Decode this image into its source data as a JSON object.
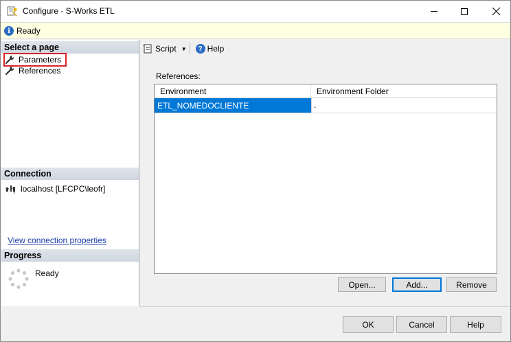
{
  "window": {
    "title": "Configure - S-Works ETL",
    "icon": "configure-icon"
  },
  "status": {
    "text": "Ready",
    "icon": "info-icon"
  },
  "select_page": {
    "header": "Select a page",
    "items": [
      {
        "label": "Parameters",
        "icon": "wrench-icon",
        "selected": true
      },
      {
        "label": "References",
        "icon": "wrench-icon",
        "selected": false
      }
    ]
  },
  "connection": {
    "header": "Connection",
    "server": "localhost [LFCPC\\leofr]",
    "link": "View connection properties"
  },
  "progress": {
    "header": "Progress",
    "text": "Ready"
  },
  "toolbar": {
    "script_label": "Script",
    "help_label": "Help"
  },
  "references": {
    "label": "References:",
    "columns": [
      "Environment",
      "Environment Folder"
    ],
    "rows": [
      [
        "ETL_NOMEDOCLIENTE",
        "."
      ]
    ]
  },
  "ref_buttons": {
    "open": "Open...",
    "add": "Add...",
    "remove": "Remove"
  },
  "dialog_buttons": {
    "ok": "OK",
    "cancel": "Cancel",
    "help": "Help"
  },
  "colors": {
    "selection": "#0078d7",
    "status_background": "#ffffe1",
    "highlight_outline": "#d8232a"
  }
}
